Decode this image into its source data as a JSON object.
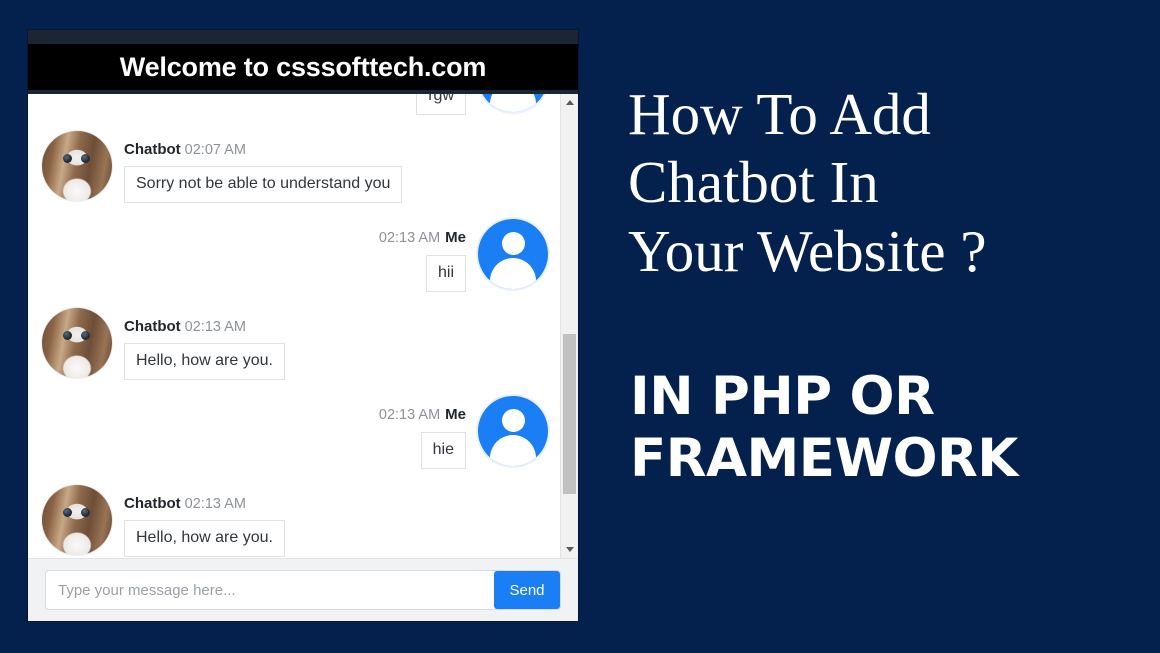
{
  "page": {
    "background_color": "#04204d"
  },
  "chat_widget": {
    "header": {
      "title": "Welcome to csssofttech.com"
    },
    "messages": [
      {
        "sender": "me",
        "author": "",
        "time": "",
        "text": "rgw",
        "avatar_icon": "user-avatar-icon"
      },
      {
        "sender": "bot",
        "author": "Chatbot",
        "time": "02:07 AM",
        "text": "Sorry not be able to understand you",
        "avatar_icon": "robot-avatar-icon"
      },
      {
        "sender": "me",
        "author": "Me",
        "time": "02:13 AM",
        "text": "hii",
        "avatar_icon": "user-avatar-icon"
      },
      {
        "sender": "bot",
        "author": "Chatbot",
        "time": "02:13 AM",
        "text": "Hello, how are you.",
        "avatar_icon": "robot-avatar-icon"
      },
      {
        "sender": "me",
        "author": "Me",
        "time": "02:13 AM",
        "text": "hie",
        "avatar_icon": "user-avatar-icon"
      },
      {
        "sender": "bot",
        "author": "Chatbot",
        "time": "02:13 AM",
        "text": "Hello, how are you.",
        "avatar_icon": "robot-avatar-icon"
      }
    ],
    "scrollbar": {
      "up_arrow_icon": "chevron-up-icon",
      "down_arrow_icon": "chevron-down-icon"
    },
    "composer": {
      "placeholder": "Type your message here...",
      "value": "",
      "send_label": "Send",
      "send_color": "#1a7ef5"
    }
  },
  "promo": {
    "title_line1": "How To Add",
    "title_line2": "Chatbot In",
    "title_line3": "Your Website ?",
    "subtitle_line1": "IN PHP OR",
    "subtitle_line2": "FRAMEWORK"
  }
}
